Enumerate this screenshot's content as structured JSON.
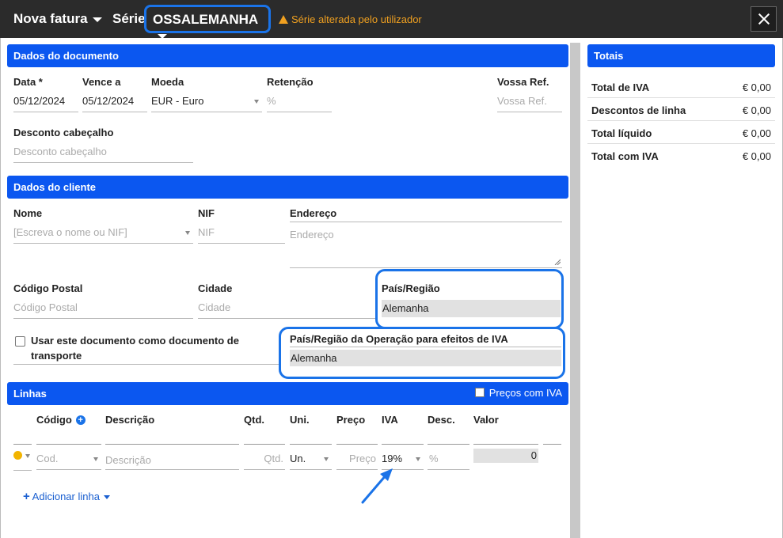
{
  "header": {
    "title": "Nova fatura",
    "serie_label": "Série",
    "serie_value": "OSSALEMANHA",
    "warning": "Série alterada pelo utilizador"
  },
  "documento": {
    "section_title": "Dados do documento",
    "data_label": "Data *",
    "data_value": "05/12/2024",
    "vence_label": "Vence a",
    "vence_value": "05/12/2024",
    "moeda_label": "Moeda",
    "moeda_value": "EUR - Euro",
    "retencao_label": "Retenção",
    "retencao_placeholder": "%",
    "vossa_ref_label": "Vossa Ref.",
    "vossa_ref_placeholder": "Vossa Ref.",
    "desconto_label": "Desconto cabeçalho",
    "desconto_placeholder": "Desconto cabeçalho"
  },
  "cliente": {
    "section_title": "Dados do cliente",
    "nome_label": "Nome",
    "nome_placeholder": "[Escreva o nome ou NIF]",
    "nif_label": "NIF",
    "nif_placeholder": "NIF",
    "endereco_label": "Endereço",
    "endereco_placeholder": "Endereço",
    "cp_label": "Código Postal",
    "cp_placeholder": "Código Postal",
    "cidade_label": "Cidade",
    "cidade_placeholder": "Cidade",
    "pais_label": "País/Região",
    "pais_value": "Alemanha",
    "transporte_label": "Usar este documento como documento de transporte",
    "pais_iva_label": "País/Região da Operação para efeitos de IVA",
    "pais_iva_value": "Alemanha"
  },
  "linhas": {
    "section_title": "Linhas",
    "precos_iva_label": "Preços com IVA",
    "headers": {
      "codigo": "Código",
      "descricao": "Descrição",
      "qtd": "Qtd.",
      "uni": "Uni.",
      "preco": "Preço",
      "iva": "IVA",
      "desc": "Desc.",
      "valor": "Valor"
    },
    "row": {
      "codigo_placeholder": "Cod.",
      "descricao_placeholder": "Descrição",
      "qtd_placeholder": "Qtd.",
      "uni_value": "Un.",
      "preco_placeholder": "Preço",
      "iva_value": "19%",
      "desc_placeholder": "%",
      "valor_value": "0"
    },
    "add_line_label": "Adicionar linha"
  },
  "totais": {
    "section_title": "Totais",
    "rows": [
      {
        "label": "Total de IVA",
        "value": "€ 0,00"
      },
      {
        "label": "Descontos de linha",
        "value": "€ 0,00"
      },
      {
        "label": "Total líquido",
        "value": "€ 0,00"
      },
      {
        "label": "Total com IVA",
        "value": "€ 0,00"
      }
    ]
  },
  "colors": {
    "accent": "#0b57f0",
    "highlight": "#1a73e8",
    "warning": "#f0a020",
    "topbar": "#2b2b2b"
  }
}
